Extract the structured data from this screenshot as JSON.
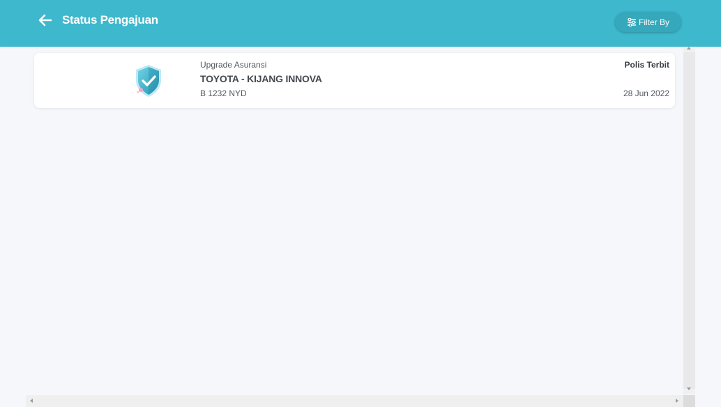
{
  "header": {
    "title": "Status Pengajuan",
    "filter_label": "Filter By",
    "back_icon": "arrow-left-icon",
    "filter_icon": "sliders-icon",
    "background_color": "#3db8cc"
  },
  "submissions": [
    {
      "type": "Upgrade Asuransi",
      "vehicle": "TOYOTA - KIJANG INNOVA",
      "plate": "B 1232 NYD",
      "status": "Polis Terbit",
      "date": "28 Jun 2022",
      "icon": "shield-check-icon"
    }
  ]
}
